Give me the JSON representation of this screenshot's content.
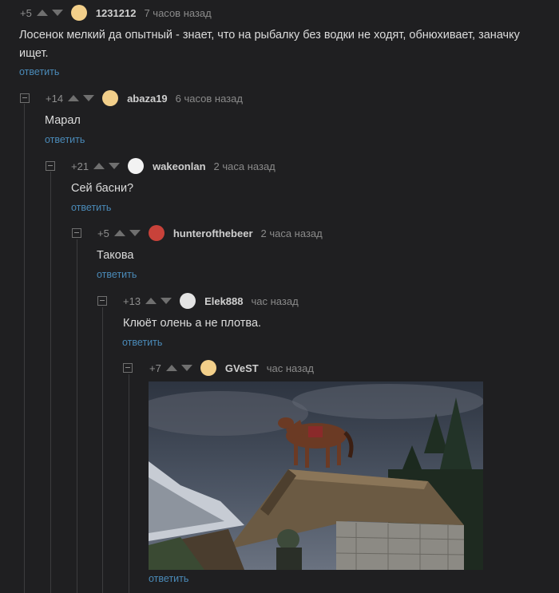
{
  "comments": [
    {
      "rating": "+5",
      "author": "1231212",
      "time": "7 часов назад",
      "text": "Лосенок мелкий да опытный - знает, что на рыбалку без водки не ходят, обнюхивает, заначку ищет.",
      "reply": "ответить"
    },
    {
      "rating": "+14",
      "author": "abaza19",
      "time": "6 часов назад",
      "text": "Марал",
      "reply": "ответить"
    },
    {
      "rating": "+21",
      "author": "wakeonlan",
      "time": "2 часа назад",
      "text": "Сей басни?",
      "reply": "ответить"
    },
    {
      "rating": "+5",
      "author": "hunterofthebeer",
      "time": "2 часа назад",
      "text": "Такова",
      "reply": "ответить"
    },
    {
      "rating": "+13",
      "author": "Elek888",
      "time": "час назад",
      "text": "Клюёт олень а не плотва.",
      "reply": "ответить"
    },
    {
      "rating": "+7",
      "author": "GVeST",
      "time": "час назад",
      "text": "",
      "reply": "ответить"
    }
  ],
  "colors": {
    "background": "#1f1f21",
    "link": "#4a8ab8",
    "text": "#dcdcdc",
    "muted": "#8a8a8a"
  }
}
